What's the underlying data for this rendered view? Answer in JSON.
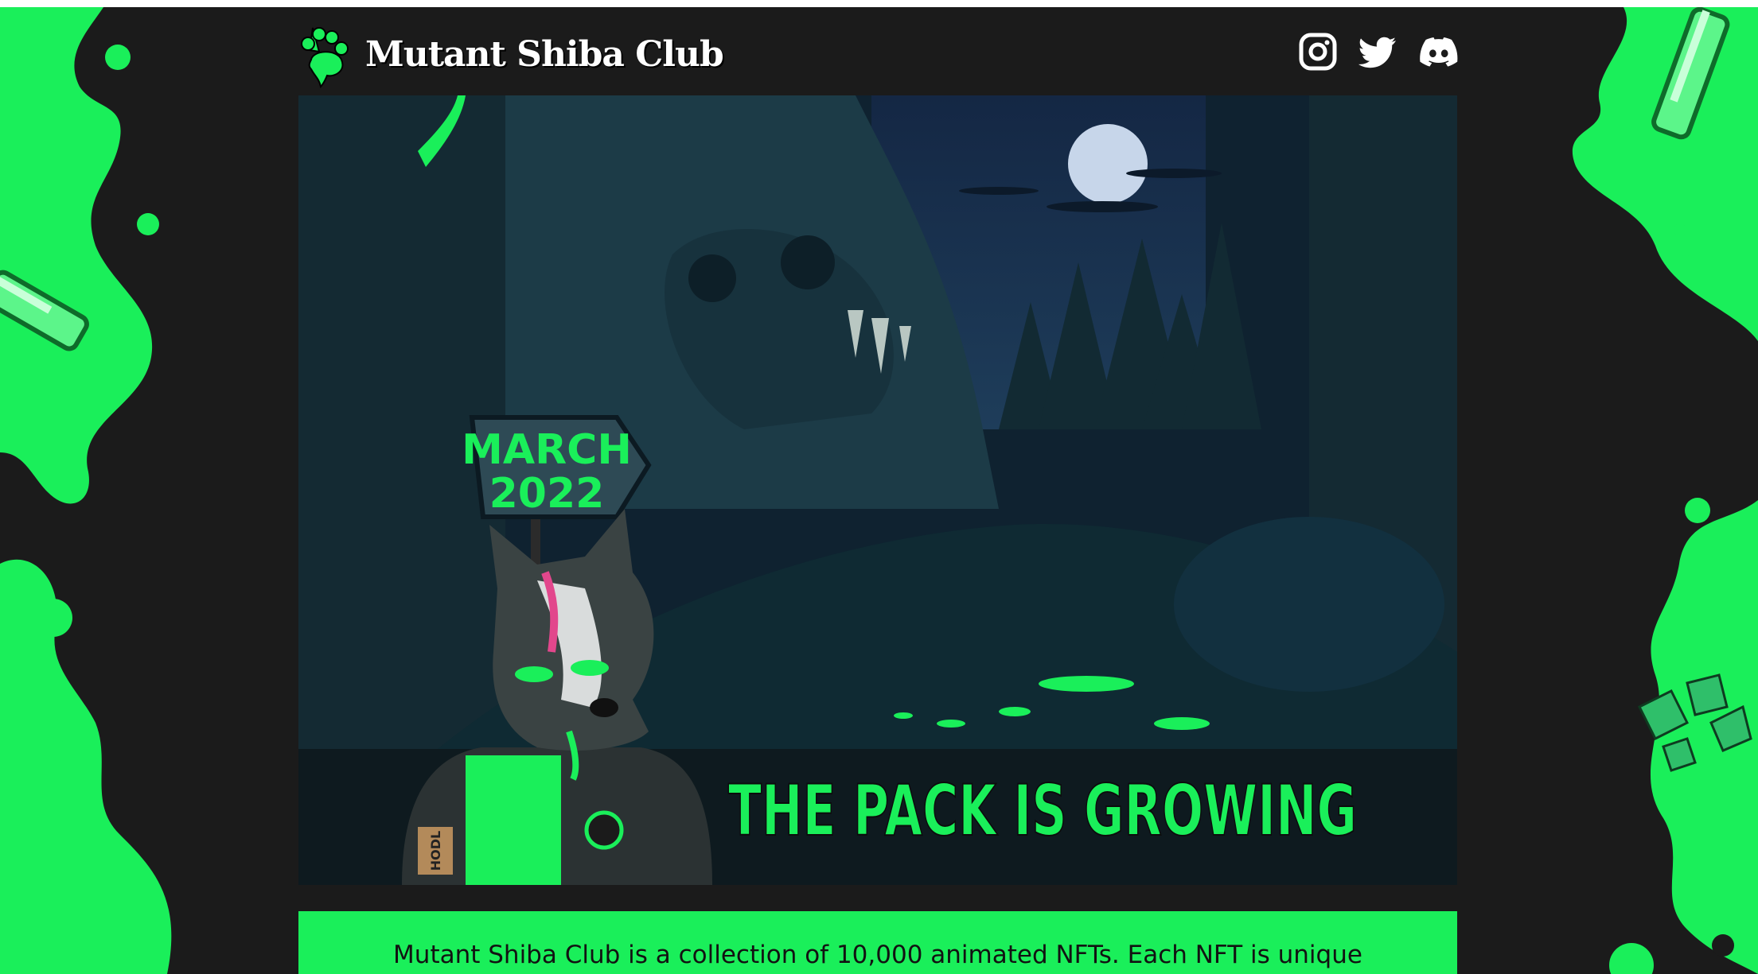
{
  "site": {
    "name": "Mutant Shiba Club",
    "accent_color": "#1aef5a",
    "background_color": "#1b1b1b"
  },
  "header": {
    "logo_icon": "paw-icon",
    "title": "Mutant Shiba Club",
    "social_links": [
      {
        "name": "instagram-icon"
      },
      {
        "name": "twitter-icon"
      },
      {
        "name": "discord-icon"
      }
    ]
  },
  "hero": {
    "sign_line1": "MARCH",
    "sign_line2": "2022",
    "banner_text": "THE PACK IS GROWING",
    "patch_text": "HODL"
  },
  "description": {
    "text": "Mutant Shiba Club is a collection of 10,000 animated NFTs. Each NFT is unique"
  }
}
